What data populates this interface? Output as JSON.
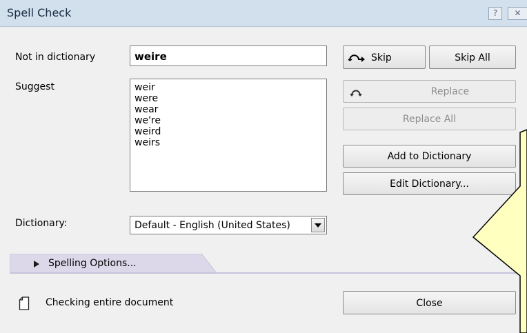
{
  "window": {
    "title": "Spell Check",
    "help_label": "?",
    "close_label": "✕"
  },
  "not_in_dictionary": {
    "label": "Not in dictionary",
    "value": "weire"
  },
  "suggest": {
    "label": "Suggest",
    "items": [
      "weir",
      "were",
      "wear",
      "we're",
      "weird",
      "weirs"
    ]
  },
  "dictionary": {
    "label": "Dictionary:",
    "selected": "Default - English (United States)"
  },
  "buttons": {
    "skip": "Skip",
    "skip_all": "Skip All",
    "replace": "Replace",
    "replace_all": "Replace All",
    "add_to_dictionary": "Add to Dictionary",
    "edit_dictionary": "Edit Dictionary...",
    "close": "Close"
  },
  "options_tab": {
    "label": "Spelling Options..."
  },
  "status": {
    "text": "Checking entire document"
  },
  "icons": {
    "skip": "skip-arrow-icon",
    "replace": "replace-arrow-icon",
    "expand": "triangle-right-icon",
    "document": "document-icon"
  },
  "colors": {
    "titlebar": "#d2dfec",
    "tooltip_fill": "#ffffc0",
    "options_tab": "#dcd8ea"
  }
}
